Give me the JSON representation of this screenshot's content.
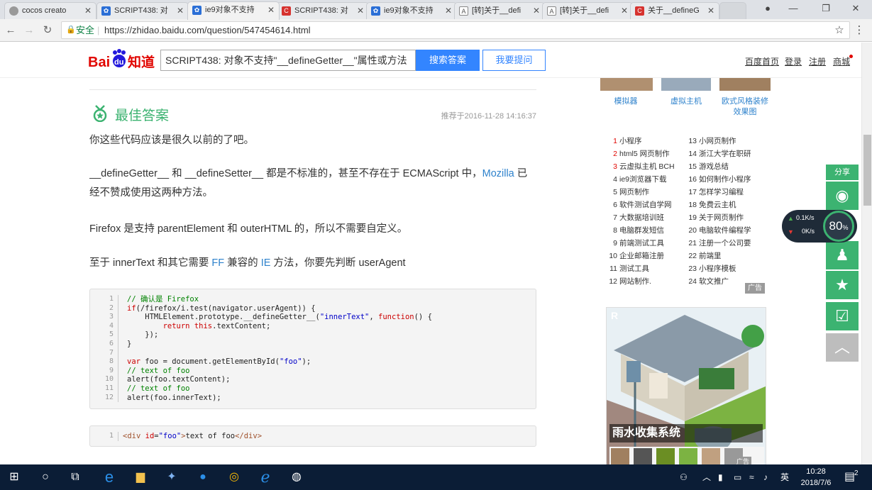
{
  "browser": {
    "tabs": [
      {
        "title": "cocos creato",
        "icon": "circle-icon",
        "color": "#999999"
      },
      {
        "title": "SCRIPT438: 对",
        "icon": "baidu-paw-icon",
        "color": "#2b6fd6"
      },
      {
        "title": "ie9对象不支持",
        "icon": "baidu-paw-icon",
        "color": "#2b6fd6"
      },
      {
        "title": "SCRIPT438: 对",
        "icon": "csdn-icon",
        "color": "#d6322f"
      },
      {
        "title": "ie9对象不支持",
        "icon": "baidu-paw-icon",
        "color": "#2b6fd6"
      },
      {
        "title": "[转]关于__defi",
        "icon": "blog-icon",
        "color": "#555555"
      },
      {
        "title": "[转]关于__defi",
        "icon": "blog-icon",
        "color": "#555555"
      },
      {
        "title": "关于__defineG",
        "icon": "csdn-icon",
        "color": "#d6322f"
      }
    ],
    "active_tab": 2,
    "secure_label": "安全",
    "url": "https://zhidao.baidu.com/question/547454614.html"
  },
  "header": {
    "logo_text": "Bai知道",
    "search_value": "SCRIPT438: 对象不支持\"__defineGetter__\"属性或方法",
    "search_button": "搜索答案",
    "ask_button": "我要提问",
    "links": [
      "百度首页",
      "登录",
      "注册",
      "商城"
    ]
  },
  "answer": {
    "title": "最佳答案",
    "recommended": "推荐于2016-11-28 14:16:37",
    "p1": "你这些代码应该是很久以前的了吧。",
    "p2a": "__defineGetter__ 和 __defineSetter__ 都是不标准的，甚至不存在于 ECMAScript 中，",
    "p2_link": "Mozilla",
    "p2b": " 已经不赞成使用这两种方法。",
    "p3": "Firefox 是支持 parentElement 和 outerHTML 的，所以不需要自定义。",
    "p4a": "至于 innerText 和其它需要 ",
    "p4_link1": "FF",
    "p4b": " 兼容的 ",
    "p4_link2": "IE",
    "p4c": " 方法，你要先判断 userAgent",
    "code1_lines": [
      "1",
      "2",
      "3",
      "4",
      "5",
      "6",
      "7",
      "8",
      "9",
      "10",
      "11",
      "12"
    ],
    "code2_line": "1"
  },
  "sidebar": {
    "thumb_labels": [
      "模拟器",
      "虚拟主机",
      "欧式风格装修效果图"
    ],
    "rank_left": [
      {
        "n": "1",
        "t": "小程序"
      },
      {
        "n": "2",
        "t": "html5 网页制作"
      },
      {
        "n": "3",
        "t": "云虚拟主机 BCH"
      },
      {
        "n": "4",
        "t": "ie9浏览器下载"
      },
      {
        "n": "5",
        "t": "网页制作"
      },
      {
        "n": "6",
        "t": "软件测试自学网"
      },
      {
        "n": "7",
        "t": "大数据培训班"
      },
      {
        "n": "8",
        "t": "电脑群发短信"
      },
      {
        "n": "9",
        "t": "前端测试工具"
      },
      {
        "n": "10",
        "t": "企业邮箱注册"
      },
      {
        "n": "11",
        "t": "测试工具"
      },
      {
        "n": "12",
        "t": "网站制作."
      }
    ],
    "rank_right": [
      {
        "n": "13",
        "t": "小网页制作"
      },
      {
        "n": "14",
        "t": "浙江大学在职研"
      },
      {
        "n": "15",
        "t": "游戏总结"
      },
      {
        "n": "16",
        "t": "如何制作小程序"
      },
      {
        "n": "17",
        "t": "怎样学习编程"
      },
      {
        "n": "18",
        "t": "免费云主机"
      },
      {
        "n": "19",
        "t": "关于网页制作"
      },
      {
        "n": "20",
        "t": "电脑软件编程学"
      },
      {
        "n": "21",
        "t": "注册一个公司要"
      },
      {
        "n": "22",
        "t": "前端里"
      },
      {
        "n": "23",
        "t": "小程序模板"
      },
      {
        "n": "24",
        "t": "软文推广"
      }
    ],
    "ad_tag": "广告",
    "ad_title": "雨水收集系统",
    "ad_corner": "广告"
  },
  "share": {
    "label": "分享"
  },
  "speed": {
    "up": "0.1K/s",
    "down": "0K/s",
    "percent": "80",
    "percent_unit": "%"
  },
  "taskbar": {
    "ime": "英",
    "time": "10:28",
    "date": "2018/7/6",
    "notifications": "2"
  }
}
